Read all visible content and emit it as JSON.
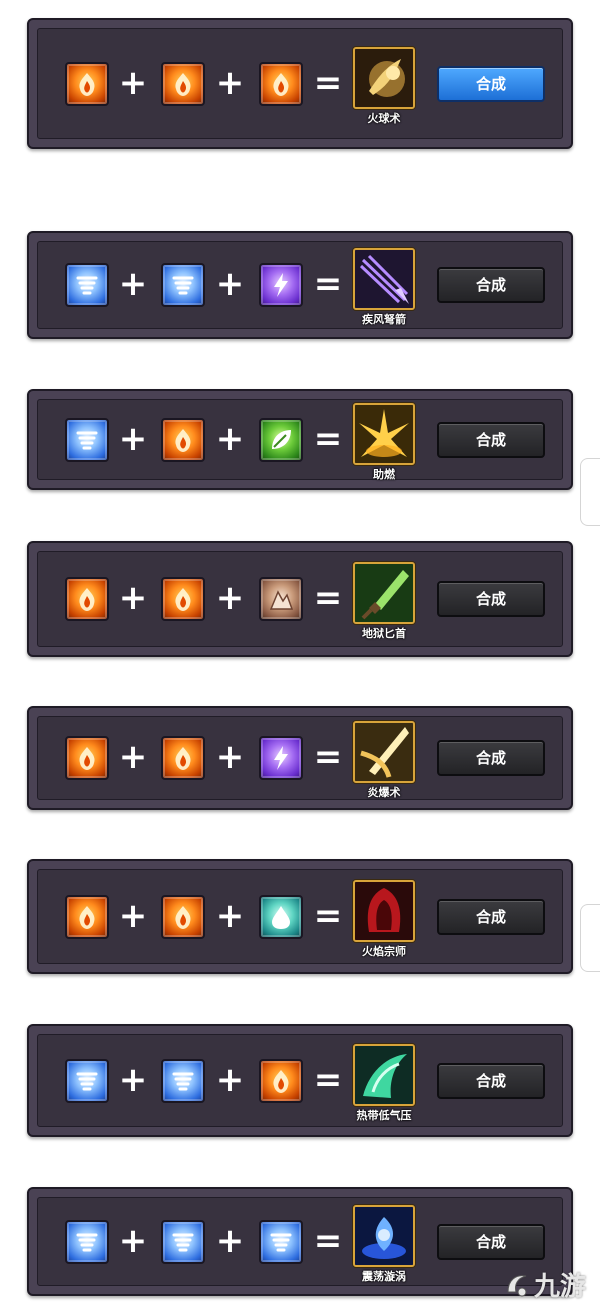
{
  "recipes": [
    {
      "inputs": [
        "fire",
        "fire",
        "fire"
      ],
      "result_icon": "fireball-icon",
      "result_name": "火球术",
      "button": "合成",
      "active": true
    },
    {
      "inputs": [
        "wind",
        "wind",
        "thunder"
      ],
      "result_icon": "gale-crossbow-icon",
      "result_name": "疾风弩箭",
      "button": "合成",
      "active": false
    },
    {
      "inputs": [
        "wind",
        "fire",
        "nature"
      ],
      "result_icon": "combustion-icon",
      "result_name": "助燃",
      "button": "合成",
      "active": false
    },
    {
      "inputs": [
        "fire",
        "fire",
        "earth"
      ],
      "result_icon": "hell-dagger-icon",
      "result_name": "地狱匕首",
      "button": "合成",
      "active": false
    },
    {
      "inputs": [
        "fire",
        "fire",
        "thunder"
      ],
      "result_icon": "blazing-burst-icon",
      "result_name": "炎爆术",
      "button": "合成",
      "active": false
    },
    {
      "inputs": [
        "fire",
        "fire",
        "water"
      ],
      "result_icon": "flame-master-icon",
      "result_name": "火焰宗师",
      "button": "合成",
      "active": false
    },
    {
      "inputs": [
        "wind",
        "wind",
        "fire"
      ],
      "result_icon": "tropical-depression-icon",
      "result_name": "热带低气压",
      "button": "合成",
      "active": false
    },
    {
      "inputs": [
        "wind",
        "wind",
        "wind"
      ],
      "result_icon": "shock-vortex-icon",
      "result_name": "震荡漩涡",
      "button": "合成",
      "active": false
    }
  ],
  "operators": {
    "plus": "+",
    "equals": "="
  },
  "watermark": {
    "text": "九游"
  },
  "colors": {
    "panel": "#4a4254",
    "panel_inner": "#38323f",
    "button_dark": "#2c2c30",
    "button_active": "#2f86e8",
    "result_border": "#d8a43a"
  }
}
